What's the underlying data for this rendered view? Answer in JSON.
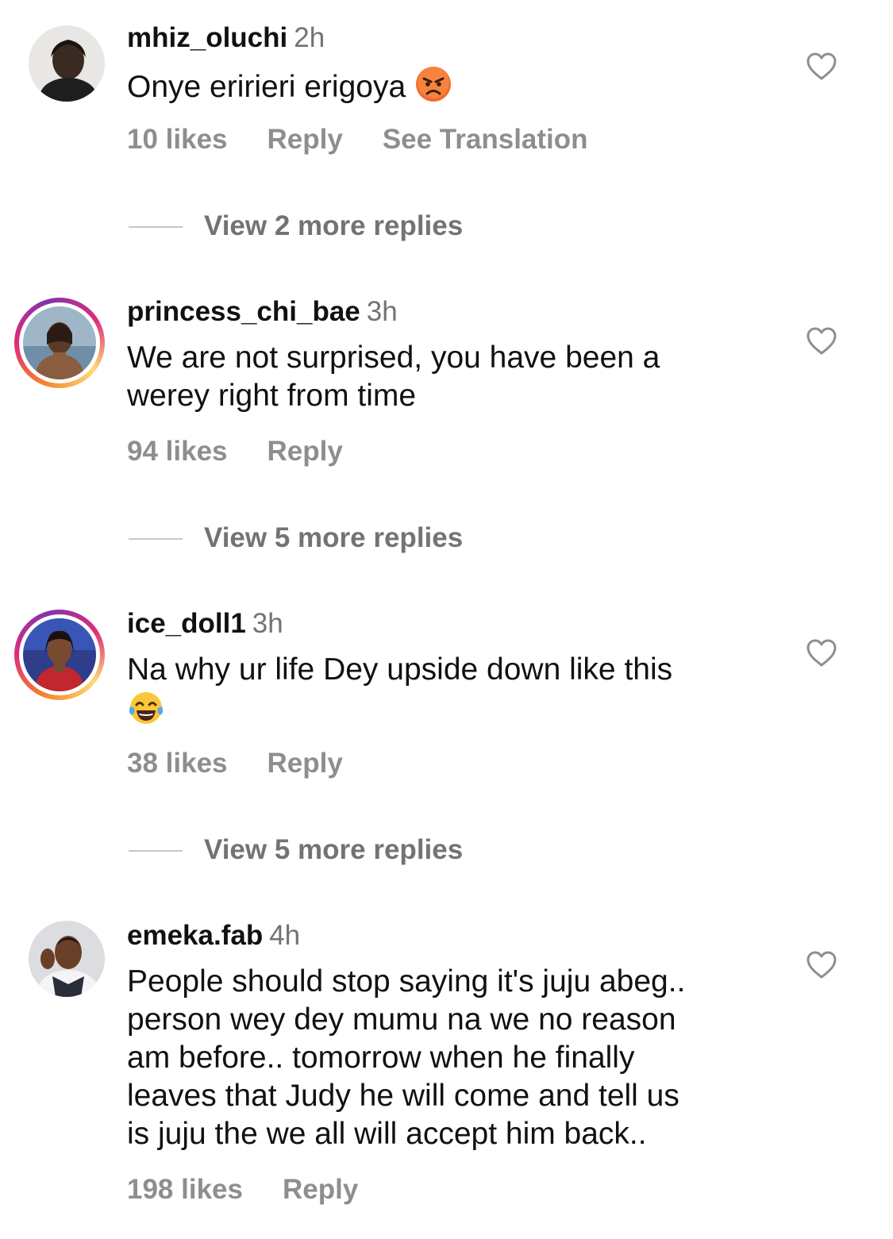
{
  "comments": [
    {
      "username": "mhiz_oluchi",
      "time": "2h",
      "text": "Onye eririeri erigoya",
      "emoji": "angry-face-emoji",
      "likes": "10 likes",
      "reply": "Reply",
      "translate": "See Translation",
      "view_replies": "View 2 more replies",
      "avatar_ring": false
    },
    {
      "username": "princess_chi_bae",
      "time": "3h",
      "text_lines": [
        "We are not surprised, you have been a",
        "werey right from time"
      ],
      "likes": "94 likes",
      "reply": "Reply",
      "view_replies": "View 5 more replies",
      "avatar_ring": true
    },
    {
      "username": "ice_doll1",
      "time": "3h",
      "text": "Na why ur life Dey upside down like this",
      "emoji": "laughing-tears-emoji",
      "likes": "38 likes",
      "reply": "Reply",
      "view_replies": "View 5 more replies",
      "avatar_ring": true
    },
    {
      "username": "emeka.fab",
      "time": "4h",
      "text_lines": [
        "People should stop saying it's juju abeg..",
        "person wey dey mumu na we no reason",
        "am before.. tomorrow when he finally",
        "leaves that Judy he will come and tell us",
        "is juju the we all will accept him back.."
      ],
      "likes": "198 likes",
      "reply": "Reply",
      "avatar_ring": false
    }
  ],
  "colors": {
    "username": "#111111",
    "muted": "#8e8e8e",
    "divider": "#c7c7c7",
    "ring_start": "#f58529",
    "ring_end": "#dd2a7b"
  }
}
